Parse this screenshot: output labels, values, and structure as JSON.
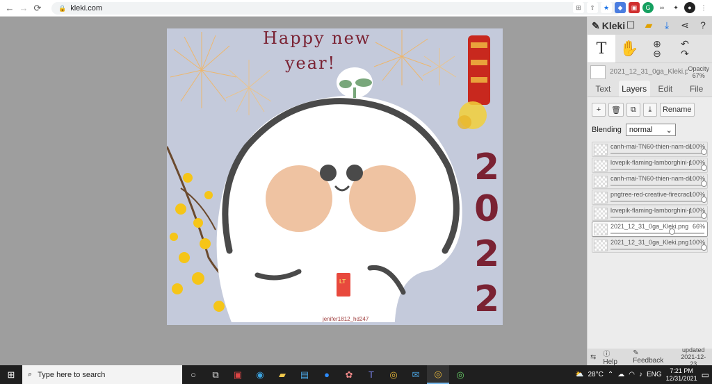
{
  "browser": {
    "url": "kleki.com",
    "nav": {
      "back": "←",
      "forward": "→",
      "reload": "⟳"
    }
  },
  "canvas": {
    "greeting_line1": "Happy new",
    "greeting_line2": "year!",
    "year_digits": [
      "2",
      "0",
      "2",
      "2"
    ],
    "envelope_text": "LT",
    "watermark": "jenifer1812_hd247",
    "background_color": "#c4cadb"
  },
  "sidebar": {
    "logo": "Kleki",
    "file": {
      "name": "2021_12_31_0ga_Kleki.png",
      "opacity_label": "Opacity",
      "opacity_value": "67%"
    },
    "tabs": [
      "Text",
      "Layers",
      "Edit",
      "File"
    ],
    "active_tab": "Layers",
    "actions": {
      "add": "+",
      "delete": "🗑",
      "duplicate": "⧉",
      "merge": "⤓",
      "rename": "Rename"
    },
    "blending": {
      "label": "Blending",
      "value": "normal"
    },
    "layers": [
      {
        "name": "canh-mai-TN60-thien-nam-de",
        "opacity": "100%",
        "value": 1.0,
        "selected": false
      },
      {
        "name": "lovepik-flaming-lamborghini-p",
        "opacity": "100%",
        "value": 1.0,
        "selected": false
      },
      {
        "name": "canh-mai-TN60-thien-nam-de",
        "opacity": "100%",
        "value": 1.0,
        "selected": false
      },
      {
        "name": "pngtree-red-creative-firecrack",
        "opacity": "100%",
        "value": 1.0,
        "selected": false
      },
      {
        "name": "lovepik-flaming-lamborghini-p",
        "opacity": "100%",
        "value": 1.0,
        "selected": false
      },
      {
        "name": "2021_12_31_0ga_Kleki.png c",
        "opacity": "66%",
        "value": 0.66,
        "selected": true
      },
      {
        "name": "2021_12_31_0ga_Kleki.png",
        "opacity": "100%",
        "value": 1.0,
        "selected": false
      }
    ],
    "bottom": {
      "help": "Help",
      "feedback": "Feedback",
      "updated_label": "updated",
      "updated_date": "2021-12-23"
    }
  },
  "taskbar": {
    "search_placeholder": "Type here to search",
    "weather": "28°C",
    "lang": "ENG",
    "time": "7:21 PM",
    "date": "12/31/2021"
  }
}
